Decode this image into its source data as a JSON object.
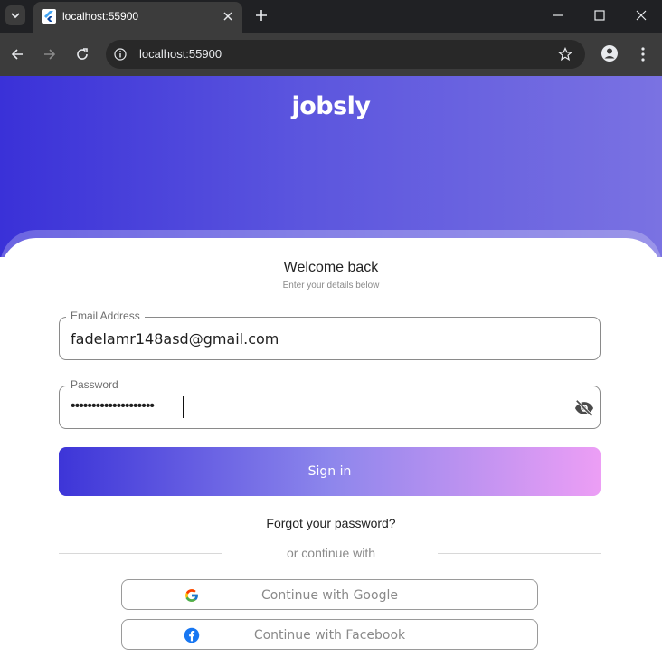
{
  "browser": {
    "tab_title": "localhost:55900",
    "url": "localhost:55900"
  },
  "app": {
    "brand": "jobsly",
    "welcome": "Welcome back",
    "subtitle": "Enter your details below"
  },
  "form": {
    "email_label": "Email Address",
    "email_value": "fadelamr148asd@gmail.com",
    "password_label": "Password",
    "password_masked": "••••••••••••••••••••",
    "signin_label": "Sign in",
    "forgot_label": "Forgot your password?"
  },
  "alt": {
    "divider_text": "or continue with",
    "google_label": "Continue with Google",
    "facebook_label": "Continue with Facebook"
  },
  "colors": {
    "hero_start": "#3a31d8",
    "hero_end": "#7a72e2",
    "button_start": "#3d35d8",
    "button_end": "#ec9ef5"
  },
  "icons": {
    "password_toggle": "eye-off-icon",
    "google": "google-icon",
    "facebook": "facebook-icon"
  }
}
